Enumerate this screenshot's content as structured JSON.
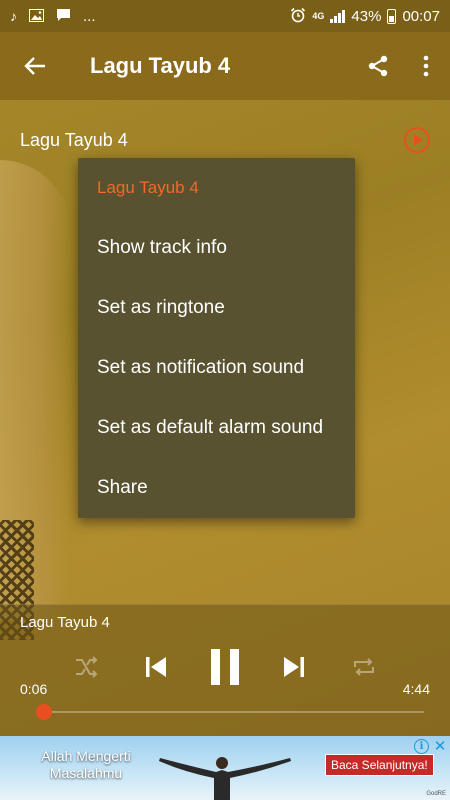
{
  "status_bar": {
    "network": "4G",
    "battery": "43%",
    "time": "00:07",
    "more": "..."
  },
  "app_bar": {
    "title": "Lagu Tayub 4"
  },
  "track": {
    "title": "Lagu Tayub 4"
  },
  "menu": {
    "header": "Lagu Tayub 4",
    "items": [
      {
        "label": "Show track info"
      },
      {
        "label": "Set as ringtone"
      },
      {
        "label": "Set as notification sound"
      },
      {
        "label": "Set as default alarm sound"
      },
      {
        "label": "Share"
      }
    ]
  },
  "player": {
    "now_playing": "Lagu Tayub 4",
    "current_time": "0:06",
    "total_time": "4:44",
    "progress": 0.021
  },
  "ad": {
    "headline": "Allah Mengerti Masalahmu",
    "cta": "Baca Selanjutnya!",
    "info": "i",
    "close": "✕",
    "badge": "GodRE"
  },
  "colors": {
    "accent": "#e8511f",
    "menu_bg": "#585230",
    "app_bar_bg": "#8a6b1c"
  },
  "icons": {
    "status": [
      "music-note-icon",
      "image-icon",
      "message-icon",
      "alarm-icon",
      "signal-icon",
      "battery-icon"
    ],
    "app_bar": [
      "back-arrow-icon",
      "share-icon",
      "more-vert-icon"
    ],
    "controls": [
      "shuffle-icon",
      "previous-icon",
      "pause-icon",
      "next-icon",
      "repeat-icon"
    ]
  }
}
